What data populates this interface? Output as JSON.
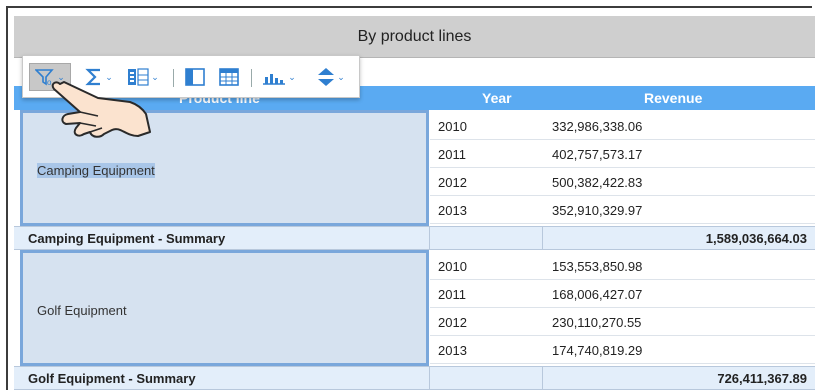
{
  "report": {
    "title": "By product lines",
    "columns": {
      "product": "Product line",
      "year": "Year",
      "revenue": "Revenue"
    }
  },
  "toolbar": {
    "icons": [
      "filter-icon",
      "sum-icon",
      "columns-icon",
      "layout-icon",
      "grid-icon",
      "chart-icon",
      "sort-icon"
    ]
  },
  "groups": [
    {
      "name": "Camping Equipment",
      "rows": [
        {
          "year": "2010",
          "revenue": "332,986,338.06"
        },
        {
          "year": "2011",
          "revenue": "402,757,573.17"
        },
        {
          "year": "2012",
          "revenue": "500,382,422.83"
        },
        {
          "year": "2013",
          "revenue": "352,910,329.97"
        }
      ],
      "summary_label": "Camping Equipment - Summary",
      "summary_value": "1,589,036,664.03"
    },
    {
      "name": "Golf Equipment",
      "rows": [
        {
          "year": "2010",
          "revenue": "153,553,850.98"
        },
        {
          "year": "2011",
          "revenue": "168,006,427.07"
        },
        {
          "year": "2012",
          "revenue": "230,110,270.55"
        },
        {
          "year": "2013",
          "revenue": "174,740,819.29"
        }
      ],
      "summary_label": "Golf Equipment - Summary",
      "summary_value": "726,411,367.89"
    }
  ],
  "colors": {
    "header": "#5aaaf2",
    "selection": "#d6e2f0",
    "selection_border": "#7aa7db",
    "summary": "#e3eefa"
  }
}
